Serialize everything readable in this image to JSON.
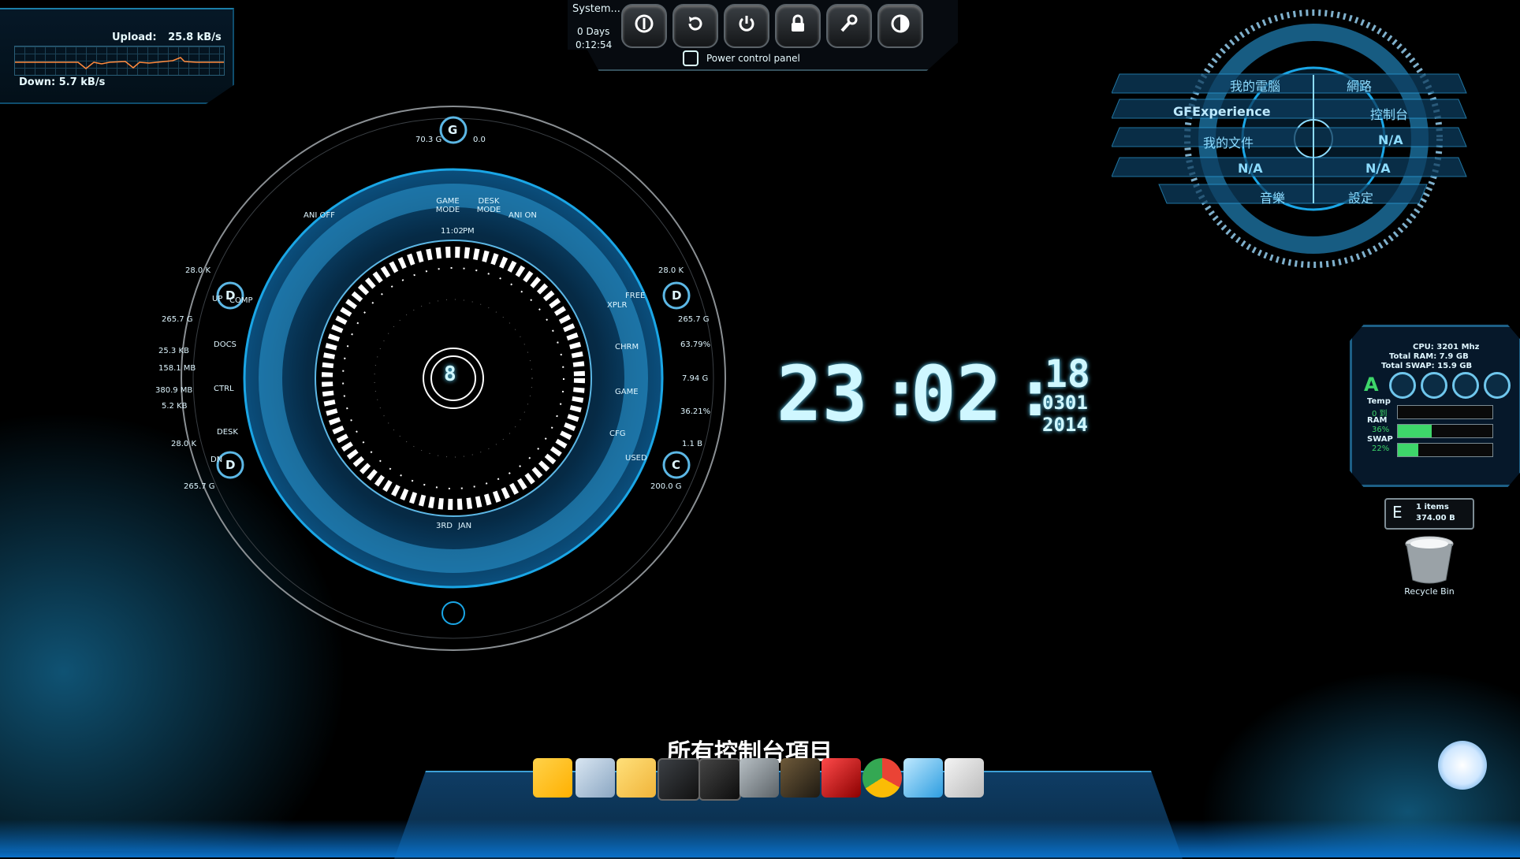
{
  "network": {
    "upload_label": "Upload:",
    "upload_value": "25.8 kB/s",
    "down_label": "Down:",
    "down_value": "5.7 kB/s"
  },
  "power": {
    "system_label": "System...",
    "days": "0 Days",
    "uptime": "0:12:54",
    "panel_label": "Power control panel",
    "buttons": [
      "power-icon",
      "restart-icon",
      "shutdown-icon",
      "lock-icon",
      "settings-wrench-icon",
      "hibernate-icon"
    ]
  },
  "hud": {
    "center_number": "8",
    "top_badge": "G",
    "left_top_badge": "D",
    "left_bottom_badge": "D",
    "right_top_badge": "D",
    "right_bottom_badge": "C",
    "buttons": [
      "ANI OFF",
      "GAME MODE",
      "DESK MODE",
      "ANI ON",
      "COMP",
      "DOCS",
      "CTRL",
      "DESK",
      "XPLR",
      "CHRM",
      "GAME",
      "CFG"
    ],
    "top_left_val": "70.3 G",
    "top_right_val": "0.0",
    "left_vals": [
      "28.0 K",
      "265.7 G",
      "25.3 KB",
      "158.1 MB",
      "380.9 MB",
      "5.2 KB",
      "28.0 K",
      "265.7 G"
    ],
    "right_vals": [
      "28.0 K",
      "265.7 G",
      "63.79%",
      "7.94 G",
      "36.21%",
      "1.1 B",
      "200.0 G"
    ],
    "up_label": "UP",
    "dn_label": "DN",
    "free_label": "FREE",
    "used_label": "USED",
    "time_small": "11:02",
    "pm": "PM",
    "day": "3RD",
    "month": "JAN"
  },
  "clock": {
    "hours": "23",
    "minutes": "02",
    "seconds": "18",
    "date_md": "0301",
    "year": "2014"
  },
  "radial": {
    "items": [
      "我的電腦",
      "網路",
      "GFExperience",
      "控制台",
      "我的文件",
      "N/A",
      "N/A",
      "N/A",
      "音樂",
      "設定"
    ]
  },
  "sysmon": {
    "cpu": "CPU: 3201 Mhz",
    "ram_total": "Total RAM: 7.9 GB",
    "swap_total": "Total SWAP: 15.9 GB",
    "temp_label": "Temp",
    "temp_value": "0 到",
    "ram_label": "RAM",
    "ram_pct": "36%",
    "swap_label": "SWAP",
    "swap_pct": "22%",
    "ram_fill": 0.36,
    "swap_fill": 0.22,
    "temp_fill": 0.0
  },
  "drive": {
    "letter": "E",
    "items": "1 items",
    "size": "374.00 B"
  },
  "recycle": {
    "label": "Recycle Bin"
  },
  "dock": {
    "title": "所有控制台項目",
    "icons": [
      "tools-icon",
      "files-icon",
      "folder-icon",
      "terminal-icon",
      "calculator-icon",
      "crossed-swords-icon",
      "game-character-icon",
      "guild-wars-2-icon",
      "chrome-icon",
      "app-c-icon",
      "notepad-icon"
    ]
  },
  "colors": {
    "accent": "#1aa6e6",
    "glow": "#5fd7ff",
    "bar_green": "#3ed66a"
  }
}
